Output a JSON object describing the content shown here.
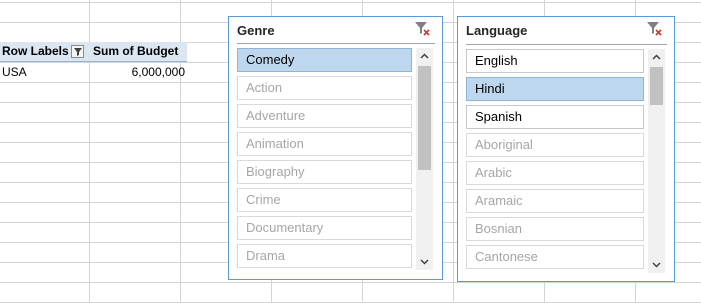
{
  "pivot": {
    "headers": [
      "Row Labels",
      "Sum of Budget"
    ],
    "rows": [
      {
        "label": "USA",
        "value": "6,000,000"
      }
    ],
    "header_bg": "#dce6f1"
  },
  "genre_slicer": {
    "title": "Genre",
    "items": [
      {
        "label": "Comedy",
        "state": "selected"
      },
      {
        "label": "Action",
        "state": "unavailable"
      },
      {
        "label": "Adventure",
        "state": "unavailable"
      },
      {
        "label": "Animation",
        "state": "unavailable"
      },
      {
        "label": "Biography",
        "state": "unavailable"
      },
      {
        "label": "Crime",
        "state": "unavailable"
      },
      {
        "label": "Documentary",
        "state": "unavailable"
      },
      {
        "label": "Drama",
        "state": "unavailable"
      }
    ]
  },
  "language_slicer": {
    "title": "Language",
    "items": [
      {
        "label": "English",
        "state": "available"
      },
      {
        "label": "Hindi",
        "state": "selected"
      },
      {
        "label": "Spanish",
        "state": "available"
      },
      {
        "label": "Aboriginal",
        "state": "unavailable"
      },
      {
        "label": "Arabic",
        "state": "unavailable"
      },
      {
        "label": "Aramaic",
        "state": "unavailable"
      },
      {
        "label": "Bosnian",
        "state": "unavailable"
      },
      {
        "label": "Cantonese",
        "state": "unavailable"
      }
    ]
  },
  "icons": {
    "clear_filter": "clear-filter-icon",
    "pivot_filter": "filter-dropdown-icon",
    "scroll_up": "chevron-up-icon",
    "scroll_down": "chevron-down-icon"
  },
  "colors": {
    "slicer_border": "#5b9bd5",
    "selected_item": "#bdd7ee",
    "clear_filter_x": "#e03030"
  }
}
